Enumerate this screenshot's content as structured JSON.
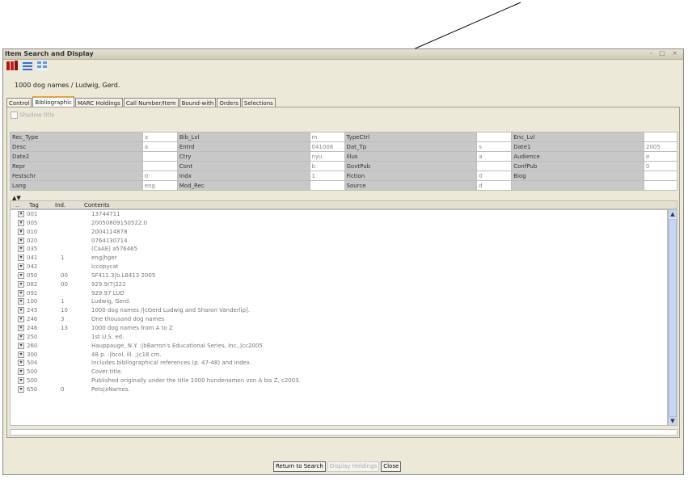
{
  "window": {
    "title": "Item Search and Display",
    "controls": "- □ ×"
  },
  "toolbar": {
    "icons": [
      "book-icon",
      "holdings-icon"
    ]
  },
  "item_title": "1000 dog names / Ludwig, Gerd.",
  "tabs": [
    {
      "label": "Control",
      "active": false
    },
    {
      "label": "Bibliographic",
      "active": true
    },
    {
      "label": "MARC Holdings",
      "active": false
    },
    {
      "label": "Call Number/Item",
      "active": false
    },
    {
      "label": "Bound-with",
      "active": false
    },
    {
      "label": "Orders",
      "active": false
    },
    {
      "label": "Selections",
      "active": false
    }
  ],
  "shadow_title": "Shadow title",
  "fixed_fields": [
    [
      [
        "Rec_Type",
        "a"
      ],
      [
        "Bib_Lvl",
        "m"
      ],
      [
        "TypeCtrl",
        ""
      ],
      [
        "Enc_Lvl",
        ""
      ]
    ],
    [
      [
        "Desc",
        "a"
      ],
      [
        "Entrd",
        "041008"
      ],
      [
        "Dat_Tp",
        "s"
      ],
      [
        "Date1",
        "2005"
      ]
    ],
    [
      [
        "Date2",
        ""
      ],
      [
        "Ctry",
        "nyu"
      ],
      [
        "Illus",
        "a"
      ],
      [
        "Audience",
        "e"
      ]
    ],
    [
      [
        "Repr",
        ""
      ],
      [
        "Cont",
        "b"
      ],
      [
        "GovtPub",
        ""
      ],
      [
        "ConfPub",
        "0"
      ]
    ],
    [
      [
        "Festschr",
        "0"
      ],
      [
        "Indx",
        "1"
      ],
      [
        "Fiction",
        "0"
      ],
      [
        "Biog",
        ""
      ]
    ],
    [
      [
        "Lang",
        "eng"
      ],
      [
        "Mod_Rec",
        ""
      ],
      [
        "Source",
        "d"
      ],
      [
        "",
        ""
      ]
    ]
  ],
  "varfield_header": {
    "dots": "..",
    "tag": "Tag",
    "ind": "Ind.",
    "contents": "Contents"
  },
  "sort_arrows": "▲▼",
  "varfields": [
    [
      "001",
      "",
      "13744711"
    ],
    [
      "005",
      "",
      "20050809150522.0"
    ],
    [
      "010",
      "",
      "  2004114878"
    ],
    [
      "020",
      "",
      "0764130714"
    ],
    [
      "035",
      "",
      "(CaAE) a576465"
    ],
    [
      "041",
      "1",
      "eng|hger"
    ],
    [
      "042",
      "",
      "lccopycat"
    ],
    [
      "050",
      "00",
      "SF411.3|b.L8413 2005"
    ],
    [
      "082",
      "00",
      "929.9/7|222"
    ],
    [
      "092",
      "",
      "929.97 LUD"
    ],
    [
      "100",
      "1",
      "Ludwig, Gerd."
    ],
    [
      "245",
      "10",
      "1000 dog names /|cGerd Ludwig and Sharon Vanderlip]."
    ],
    [
      "246",
      "3",
      "One thousand dog names"
    ],
    [
      "246",
      "13",
      "1000 dog names from A to Z"
    ],
    [
      "250",
      "",
      "1st U.S. ed."
    ],
    [
      "260",
      "",
      "Hauppauge, N.Y. :|bBarron's Educational Series, Inc.,|cc2005."
    ],
    [
      "300",
      "",
      "48 p. :|bcol. ill. ;|c18 cm."
    ],
    [
      "504",
      "",
      "Includes bibliographical references (p. 47-48) and index."
    ],
    [
      "500",
      "",
      "Cover title."
    ],
    [
      "500",
      "",
      "Published originally under the title 1000 hundenamen von A bis Z, c2003."
    ],
    [
      "650",
      "0",
      "Pets|xNames."
    ]
  ],
  "buttons": {
    "return": "Return to Search",
    "display": "Display Holdings",
    "close": "Close"
  }
}
